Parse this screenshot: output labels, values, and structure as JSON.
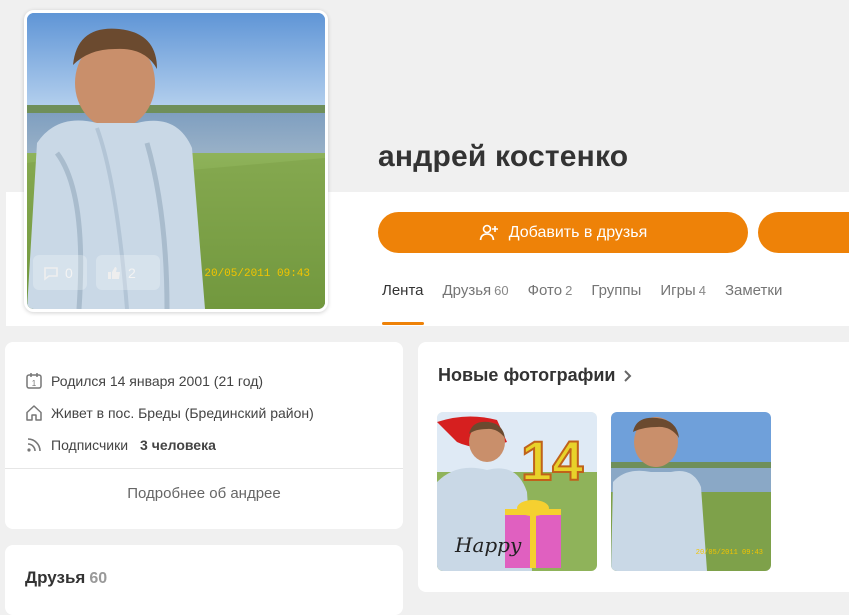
{
  "profile": {
    "name": "андрей костенко",
    "avatar_timestamp": "20/05/2011 09:43",
    "avatar_comments": "0",
    "avatar_likes": "2"
  },
  "actions": {
    "add_friend_label": "Добавить в друзья",
    "add_friend_icon": "add-user-icon"
  },
  "tabs": [
    {
      "label": "Лента",
      "count": ""
    },
    {
      "label": "Друзья",
      "count": "60"
    },
    {
      "label": "Фото",
      "count": "2"
    },
    {
      "label": "Группы",
      "count": ""
    },
    {
      "label": "Игры",
      "count": "4"
    },
    {
      "label": "Заметки",
      "count": ""
    }
  ],
  "info": {
    "born": "Родился 14 января 2001 (21 год)",
    "lives": "Живет в пос. Бреды (Брединский район)",
    "followers_label": "Подписчики",
    "followers_value": "3 человека",
    "more_link": "Подробнее об андрее"
  },
  "friends": {
    "title": "Друзья",
    "count": "60"
  },
  "photos": {
    "title": "Новые фотографии",
    "thumb1_number": "14",
    "thumb1_text": "Happy",
    "thumb2_timestamp": "20/05/2011 09:43"
  },
  "colors": {
    "accent": "#ee8208",
    "background": "#f0f0f0",
    "card": "#ffffff"
  }
}
